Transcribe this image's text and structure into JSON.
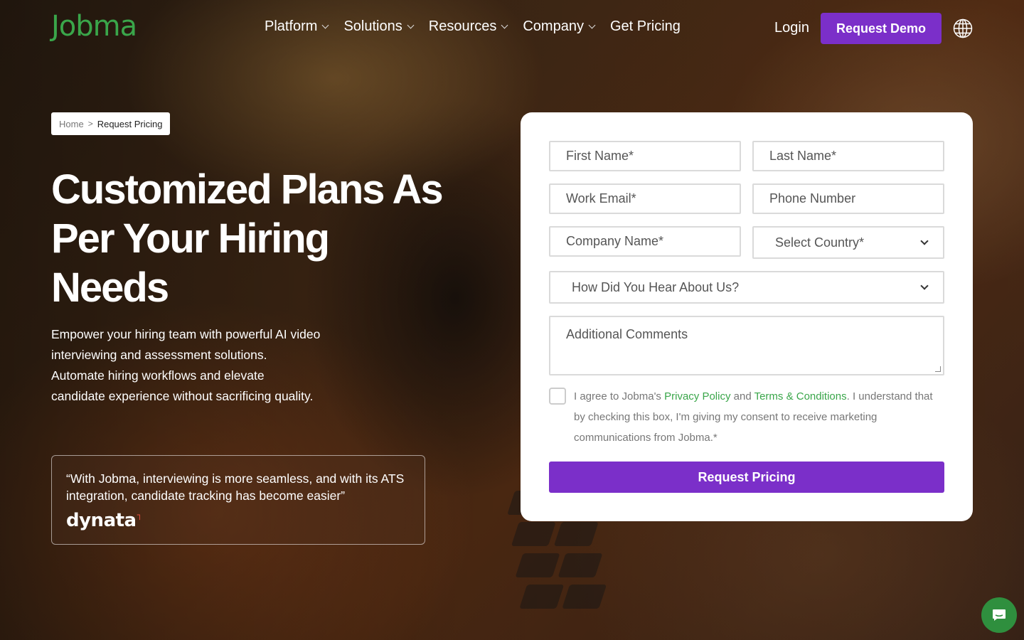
{
  "header": {
    "logo": "Jobma",
    "nav": [
      {
        "label": "Platform",
        "dropdown": true
      },
      {
        "label": "Solutions",
        "dropdown": true
      },
      {
        "label": "Resources",
        "dropdown": true
      },
      {
        "label": "Company",
        "dropdown": true
      },
      {
        "label": "Get Pricing",
        "dropdown": false
      }
    ],
    "login": "Login",
    "demo_button": "Request Demo",
    "language_icon": "globe-icon"
  },
  "breadcrumb": {
    "home": "Home",
    "separator": ">",
    "current": "Request Pricing"
  },
  "hero": {
    "title": "Customized Plans As Per Your Hiring Needs",
    "description": "Empower your hiring team with powerful AI video interviewing and assessment solutions. Automate hiring workflows and elevate candidate experience without sacrificing quality.",
    "testimonial": {
      "quote": "“With Jobma, interviewing is more seamless, and with its ATS integration, candidate tracking has become easier”",
      "company": "dynata"
    }
  },
  "form": {
    "first_name": {
      "placeholder": "First Name*",
      "value": ""
    },
    "last_name": {
      "placeholder": "Last Name*",
      "value": ""
    },
    "work_email": {
      "placeholder": "Work Email*",
      "value": ""
    },
    "phone": {
      "placeholder": "Phone Number",
      "value": ""
    },
    "company": {
      "placeholder": "Company Name*",
      "value": ""
    },
    "country": {
      "selected": "Select Country*"
    },
    "source": {
      "selected": "How Did You Hear About Us?"
    },
    "comments": {
      "placeholder": "Additional Comments",
      "value": ""
    },
    "consent": {
      "checked": false,
      "text_before": "I agree to Jobma's ",
      "privacy_link": "Privacy Policy",
      "text_and": " and ",
      "terms_link": "Terms & Conditions",
      "text_after": ". I understand that by checking this box, I'm giving my consent to receive marketing communications from Jobma.*"
    },
    "submit": "Request Pricing"
  },
  "chat_icon": "chat-bubble-icon",
  "colors": {
    "brand_green": "#3aa64a",
    "accent_purple": "#7b2fc9",
    "chat_green": "#2f8f3e"
  }
}
